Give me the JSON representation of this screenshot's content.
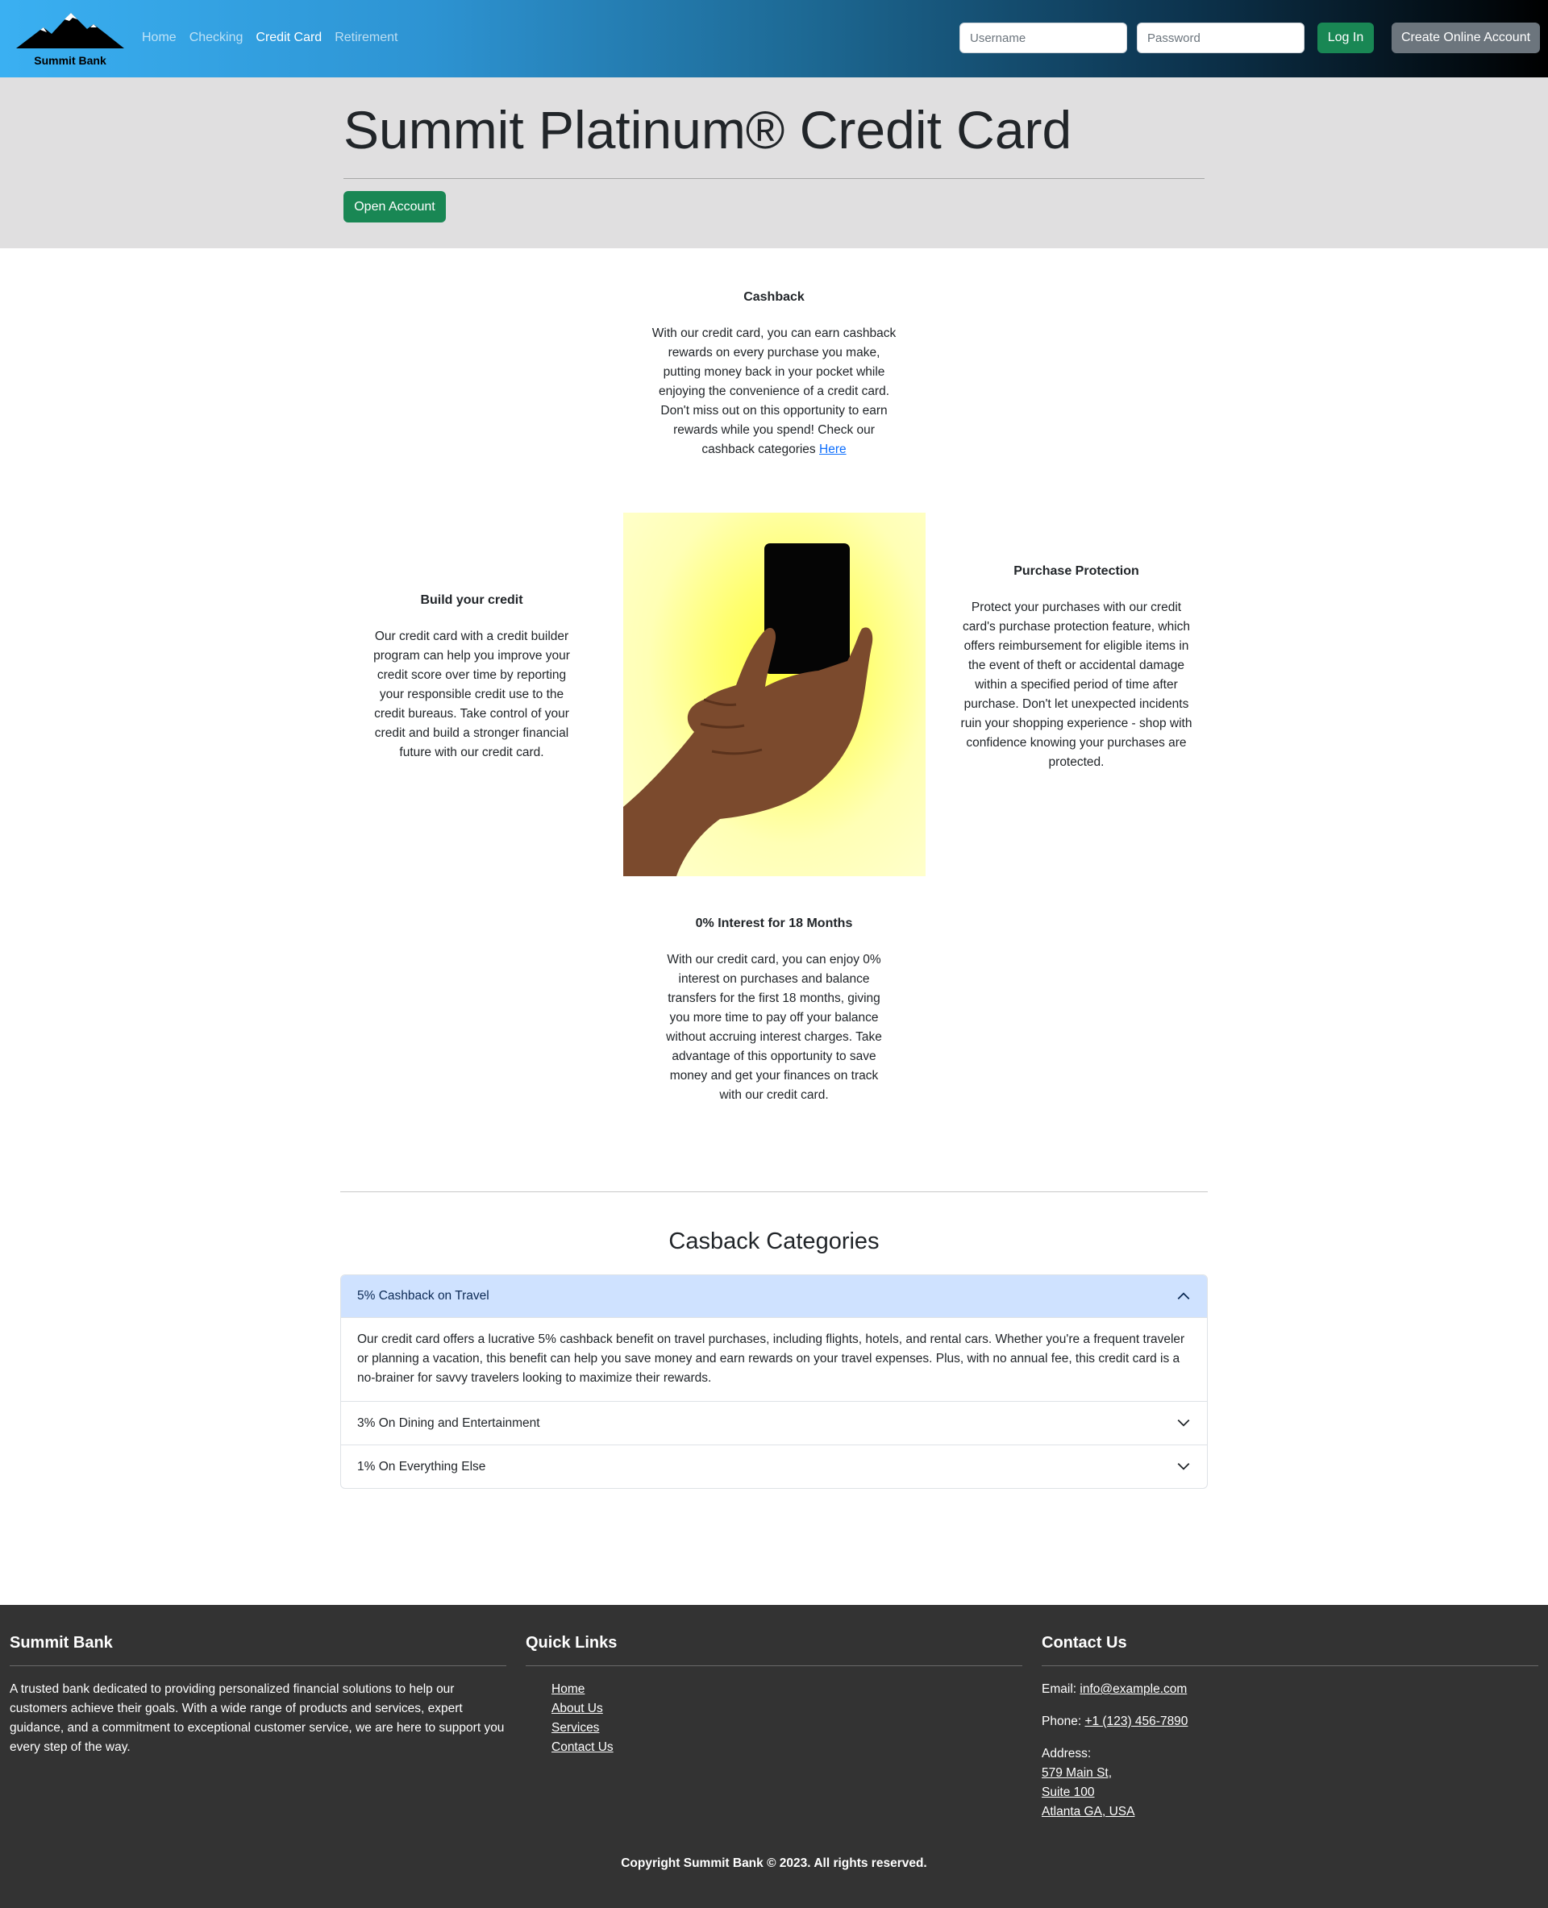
{
  "brand": {
    "name": "Summit Bank"
  },
  "nav": {
    "links": [
      {
        "label": "Home",
        "active": false
      },
      {
        "label": "Checking",
        "active": false
      },
      {
        "label": "Credit Card",
        "active": true
      },
      {
        "label": "Retirement",
        "active": false
      }
    ],
    "username_placeholder": "Username",
    "password_placeholder": "Password",
    "login_label": "Log In",
    "create_label": "Create Online Account"
  },
  "hero": {
    "title": "Summit Platinum® Credit Card",
    "open_account_label": "Open Account"
  },
  "features": {
    "cashback": {
      "title": "Cashback",
      "text": "With our credit card, you can earn cashback rewards on every purchase you make, putting money back in your pocket while enjoying the convenience of a credit card. Don't miss out on this opportunity to earn rewards while you spend! Check our cashback categories",
      "link_label": "Here"
    },
    "build": {
      "title": "Build your credit",
      "text": "Our credit card with a credit builder program can help you improve your credit score over time by reporting your responsible credit use to the credit bureaus. Take control of your credit and build a stronger financial future with our credit card."
    },
    "protection": {
      "title": "Purchase Protection",
      "text": "Protect your purchases with our credit card's purchase protection feature, which offers reimbursement for eligible items in the event of theft or accidental damage within a specified period of time after purchase. Don't let unexpected incidents ruin your shopping experience - shop with confidence knowing your purchases are protected."
    },
    "interest": {
      "title": "0% Interest for 18 Months",
      "text": "With our credit card, you can enjoy 0% interest on purchases and balance transfers for the first 18 months, giving you more time to pay off your balance without accruing interest charges. Take advantage of this opportunity to save money and get your finances on track with our credit card."
    }
  },
  "categories": {
    "title": "Casback Categories",
    "items": [
      {
        "label": "5% Cashback on Travel",
        "expanded": true,
        "body": "Our credit card offers a lucrative 5% cashback benefit on travel purchases, including flights, hotels, and rental cars. Whether you're a frequent traveler or planning a vacation, this benefit can help you save money and earn rewards on your travel expenses. Plus, with no annual fee, this credit card is a no-brainer for savvy travelers looking to maximize their rewards."
      },
      {
        "label": "3% On Dining and Entertainment",
        "expanded": false
      },
      {
        "label": "1% On Everything Else",
        "expanded": false
      }
    ]
  },
  "footer": {
    "about_title": "Summit Bank",
    "about_text": "A trusted bank dedicated to providing personalized financial solutions to help our customers achieve their goals. With a wide range of products and services, expert guidance, and a commitment to exceptional customer service, we are here to support you every step of the way.",
    "links_title": "Quick Links",
    "links": [
      "Home",
      "About Us",
      "Services",
      "Contact Us"
    ],
    "contact_title": "Contact Us",
    "email_label": "Email:",
    "email": "info@example.com",
    "phone_label": "Phone:",
    "phone": "+1 (123) 456-7890",
    "address_label": "Address:",
    "address_lines": [
      "579 Main St,",
      "Suite 100",
      "Atlanta GA, USA"
    ],
    "copyright": "Copyright Summit Bank © 2023. All rights reserved."
  },
  "colors": {
    "nav_gradient_start": "#3ab0f2",
    "nav_gradient_end": "#000000",
    "hero_bg": "#e0dfe0",
    "success_green": "#198754",
    "secondary_gray": "#6c757d",
    "accordion_active_bg": "#cfe2ff",
    "footer_bg": "#333333",
    "link_blue": "#0d6efd"
  },
  "icons": {
    "logo": "mountain-logo",
    "card_image": "hand-holding-card",
    "expanded_chevron": "chevron-up-icon",
    "collapsed_chevron": "chevron-down-icon"
  }
}
